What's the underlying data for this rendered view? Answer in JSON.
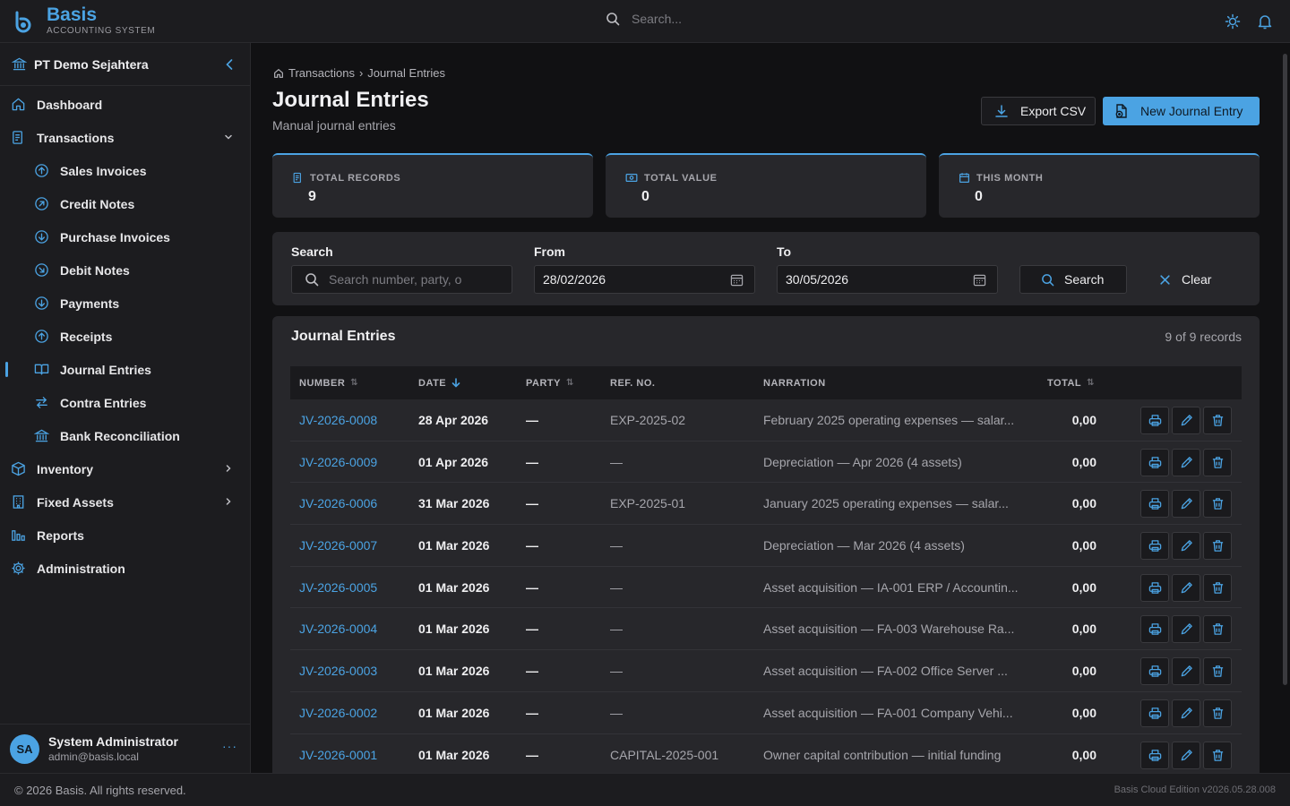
{
  "app": {
    "name": "Basis",
    "subtitle": "ACCOUNTING SYSTEM",
    "search_placeholder": "Search...",
    "accent": "#4ba3e3"
  },
  "sidebar": {
    "company": "PT Demo Sejahtera",
    "items": [
      {
        "label": "Dashboard",
        "icon": "home-icon"
      },
      {
        "label": "Transactions",
        "icon": "document-icon",
        "expanded": true
      },
      {
        "label": "Sales Invoices",
        "icon": "arrow-up-circle-icon"
      },
      {
        "label": "Credit Notes",
        "icon": "arrow-up-right-circle-icon"
      },
      {
        "label": "Purchase Invoices",
        "icon": "arrow-down-circle-icon"
      },
      {
        "label": "Debit Notes",
        "icon": "arrow-down-right-circle-icon"
      },
      {
        "label": "Payments",
        "icon": "arrow-down-circle-icon"
      },
      {
        "label": "Receipts",
        "icon": "arrow-up-circle-icon"
      },
      {
        "label": "Journal Entries",
        "icon": "book-icon",
        "active": true
      },
      {
        "label": "Contra Entries",
        "icon": "swap-icon"
      },
      {
        "label": "Bank Reconciliation",
        "icon": "bank-icon"
      },
      {
        "label": "Inventory",
        "icon": "box-icon"
      },
      {
        "label": "Fixed Assets",
        "icon": "building-icon"
      },
      {
        "label": "Reports",
        "icon": "bar-chart-icon"
      },
      {
        "label": "Administration",
        "icon": "gear-icon"
      }
    ],
    "user": {
      "initials": "SA",
      "name": "System Administrator",
      "email": "admin@basis.local",
      "more": "···"
    }
  },
  "breadcrumb": {
    "root": "Transactions",
    "separator": "›",
    "current": "Journal Entries"
  },
  "page": {
    "title": "Journal Entries",
    "subtitle": "Manual journal entries",
    "export_label": "Export CSV",
    "new_label": "New Journal Entry"
  },
  "stats": [
    {
      "label": "TOTAL RECORDS",
      "value": "9"
    },
    {
      "label": "TOTAL VALUE",
      "value": "0"
    },
    {
      "label": "THIS MONTH",
      "value": "0"
    }
  ],
  "filters": {
    "search_label": "Search",
    "search_placeholder": "Search number, party, o",
    "from_label": "From",
    "from_value": "28/02/2026",
    "to_label": "To",
    "to_value": "30/05/2026",
    "search_button": "Search",
    "clear_button": "Clear"
  },
  "table": {
    "title": "Journal Entries",
    "count": "9 of 9 records",
    "columns": [
      "NUMBER",
      "DATE",
      "PARTY",
      "REF. NO.",
      "NARRATION",
      "TOTAL"
    ],
    "rows": [
      {
        "number": "JV-2026-0008",
        "date": "28 Apr 2026",
        "party": "—",
        "ref": "EXP-2025-02",
        "narration": "February 2025 operating expenses — salar...",
        "total": "0,00"
      },
      {
        "number": "JV-2026-0009",
        "date": "01 Apr 2026",
        "party": "—",
        "ref": "—",
        "narration": "Depreciation — Apr 2026 (4 assets)",
        "total": "0,00"
      },
      {
        "number": "JV-2026-0006",
        "date": "31 Mar 2026",
        "party": "—",
        "ref": "EXP-2025-01",
        "narration": "January 2025 operating expenses — salar...",
        "total": "0,00"
      },
      {
        "number": "JV-2026-0007",
        "date": "01 Mar 2026",
        "party": "—",
        "ref": "—",
        "narration": "Depreciation — Mar 2026 (4 assets)",
        "total": "0,00"
      },
      {
        "number": "JV-2026-0005",
        "date": "01 Mar 2026",
        "party": "—",
        "ref": "—",
        "narration": "Asset acquisition — IA-001 ERP / Accountin...",
        "total": "0,00"
      },
      {
        "number": "JV-2026-0004",
        "date": "01 Mar 2026",
        "party": "—",
        "ref": "—",
        "narration": "Asset acquisition — FA-003 Warehouse Ra...",
        "total": "0,00"
      },
      {
        "number": "JV-2026-0003",
        "date": "01 Mar 2026",
        "party": "—",
        "ref": "—",
        "narration": "Asset acquisition — FA-002 Office Server ...",
        "total": "0,00"
      },
      {
        "number": "JV-2026-0002",
        "date": "01 Mar 2026",
        "party": "—",
        "ref": "—",
        "narration": "Asset acquisition — FA-001 Company Vehi...",
        "total": "0,00"
      },
      {
        "number": "JV-2026-0001",
        "date": "01 Mar 2026",
        "party": "—",
        "ref": "CAPITAL-2025-001",
        "narration": "Owner capital contribution — initial funding",
        "total": "0,00"
      }
    ]
  },
  "footer": {
    "copyright": "© 2026 Basis. All rights reserved.",
    "version": "Basis Cloud Edition v2026.05.28.008"
  }
}
